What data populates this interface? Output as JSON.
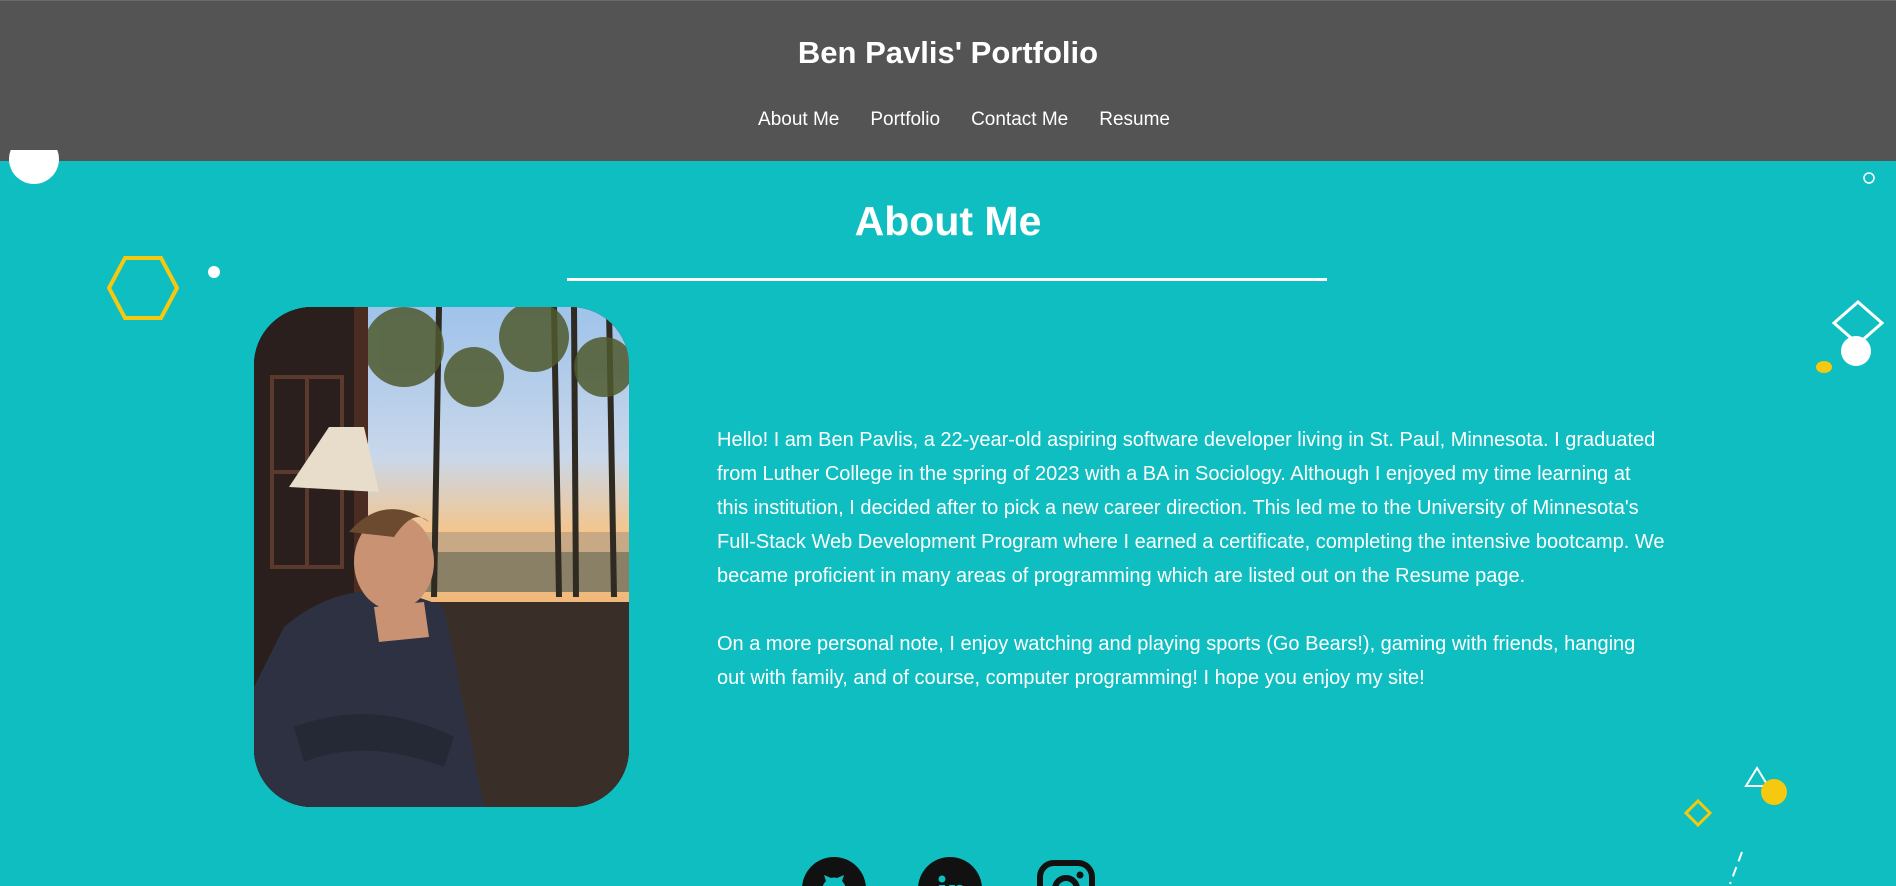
{
  "header": {
    "title": "Ben Pavlis' Portfolio",
    "nav": [
      {
        "label": "About Me"
      },
      {
        "label": "Portfolio"
      },
      {
        "label": "Contact Me"
      },
      {
        "label": "Resume"
      }
    ]
  },
  "about": {
    "title": "About Me",
    "paragraphs": [
      "Hello! I am Ben Pavlis, a 22-year-old aspiring software developer living in St. Paul, Minnesota. I graduated from Luther College in the spring of 2023 with a BA in Sociology. Although I enjoyed my time learning at this institution, I decided after to pick a new career direction. This led me to the University of Minnesota's Full-Stack Web Development Program where I earned a certificate, completing the intensive bootcamp. We became proficient in many areas of programming which are listed out on the Resume page.",
      "On a more personal note, I enjoy watching and playing sports (Go Bears!), gaming with friends, hanging out with family, and of course, computer programming! I hope you enjoy my site!"
    ]
  },
  "socials": [
    {
      "icon": "github-icon"
    },
    {
      "icon": "linkedin-icon"
    },
    {
      "icon": "instagram-icon"
    }
  ],
  "colors": {
    "background": "#0fbec0",
    "header": "#545454",
    "accent": "#f5c90f",
    "text": "#ffffff"
  }
}
